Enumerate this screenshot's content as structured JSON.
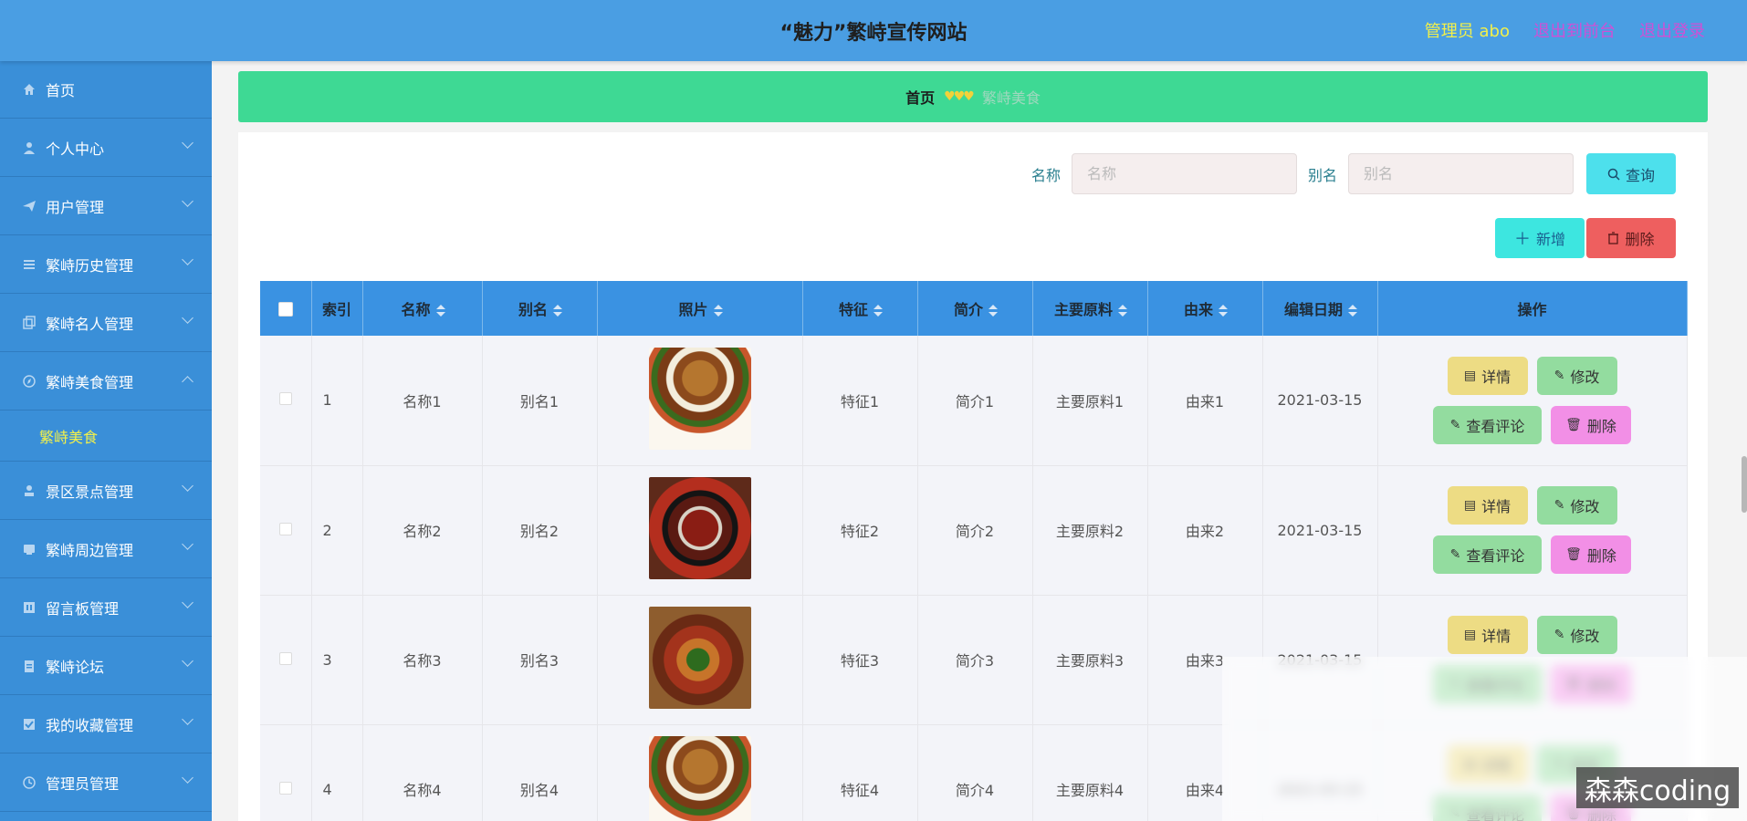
{
  "header": {
    "title": "“魅力”繁峙宣传网站",
    "admin": "管理员 abo",
    "links": [
      "退出到前台",
      "退出登录"
    ]
  },
  "sidebar": {
    "items": [
      {
        "label": "首页",
        "icon": "home-icon"
      },
      {
        "label": "个人中心",
        "icon": "user-icon"
      },
      {
        "label": "用户管理",
        "icon": "send-icon"
      },
      {
        "label": "繁峙历史管理",
        "icon": "list-icon"
      },
      {
        "label": "繁峙名人管理",
        "icon": "copy-icon"
      },
      {
        "label": "繁峙美食管理",
        "icon": "compass-icon"
      },
      {
        "label": "景区景点管理",
        "icon": "stamp-icon"
      },
      {
        "label": "繁峙周边管理",
        "icon": "folder-icon"
      },
      {
        "label": "留言板管理",
        "icon": "board-icon"
      },
      {
        "label": "繁峙论坛",
        "icon": "clipboard-icon"
      },
      {
        "label": "我的收藏管理",
        "icon": "check-icon"
      },
      {
        "label": "管理员管理",
        "icon": "clock-icon"
      }
    ],
    "submenu": "繁峙美食"
  },
  "breadcrumb": {
    "home": "首页",
    "separator": "♥♥♥",
    "current": "繁峙美食"
  },
  "search": {
    "name_label": "名称",
    "name_placeholder": "名称",
    "alias_label": "别名",
    "alias_placeholder": "别名",
    "query_button": "查询"
  },
  "actions": {
    "add_button": "新增",
    "delete_button": "删除"
  },
  "table": {
    "columns": [
      "索引",
      "名称",
      "别名",
      "照片",
      "特征",
      "简介",
      "主要原料",
      "由来",
      "编辑日期",
      "操作"
    ],
    "rows": [
      {
        "index": "1",
        "name": "名称1",
        "alias": "别名1",
        "photo": "burger",
        "feature": "特征1",
        "intro": "简介1",
        "ingredients": "主要原料1",
        "origin": "由来1",
        "date": "2021-03-15"
      },
      {
        "index": "2",
        "name": "名称2",
        "alias": "别名2",
        "photo": "pot",
        "feature": "特征2",
        "intro": "简介2",
        "ingredients": "主要原料2",
        "origin": "由来2",
        "date": "2021-03-15"
      },
      {
        "index": "3",
        "name": "名称3",
        "alias": "别名3",
        "photo": "plate",
        "feature": "特征3",
        "intro": "简介3",
        "ingredients": "主要原料3",
        "origin": "由来3",
        "date": "2021-03-15"
      },
      {
        "index": "4",
        "name": "名称4",
        "alias": "别名4",
        "photo": "burger",
        "feature": "特征4",
        "intro": "简介4",
        "ingredients": "主要原料4",
        "origin": "由来4",
        "date": "2021-03-15"
      }
    ],
    "ops": {
      "detail": "详情",
      "edit": "修改",
      "comment": "查看评论",
      "delete": "删除"
    }
  },
  "watermark": "森森coding",
  "colors": {
    "header_bg": "#4a9ee3",
    "sidebar_bg": "#3a8fd8",
    "breadcrumb_bg": "#3ed994",
    "table_header_bg": "#3a92e2",
    "accent_yellow": "#f2f04a",
    "accent_magenta": "#d04fd6"
  }
}
